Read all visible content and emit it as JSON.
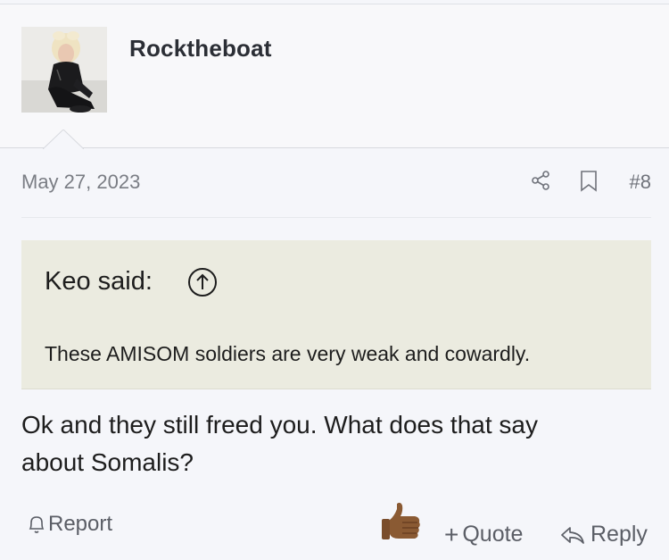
{
  "post": {
    "username": "Rocktheboat",
    "date": "May 27, 2023",
    "post_number": "#8",
    "quote": {
      "attribution": "Keo said:",
      "text": "These AMISOM soldiers are very weak and cowardly."
    },
    "body_line1": "Ok and they still freed you. What does that say",
    "body_line2": "about Somalis?",
    "actions": {
      "report_label": "Report",
      "quote_label": "Quote",
      "quote_prefix": "+",
      "reply_label": "Reply"
    },
    "reaction": "thumbs-up-emoji"
  },
  "icons": [
    "share-icon",
    "bookmark-icon",
    "arrow-up-circle-icon",
    "bell-icon",
    "reply-arrow-icon"
  ],
  "colors": {
    "quote_background": "#ebebe0",
    "page_background": "#f5f6fa",
    "muted_text": "#7a7d84"
  }
}
